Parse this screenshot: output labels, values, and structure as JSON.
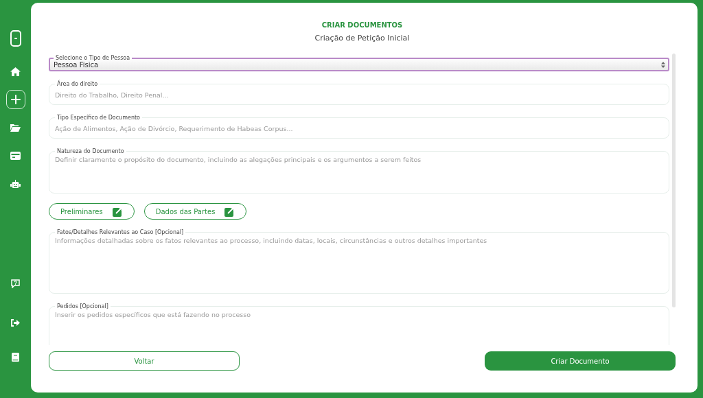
{
  "sidebar": {
    "top_items": [
      {
        "selected": false
      },
      {
        "selected": false
      },
      {
        "selected": true
      },
      {
        "selected": false
      },
      {
        "selected": false
      },
      {
        "selected": false
      }
    ],
    "bottom_items": [
      {
        "selected": false
      },
      {
        "selected": false
      },
      {
        "selected": false
      }
    ]
  },
  "header": {
    "title": "CRIAR DOCUMENTOS",
    "subtitle": "Criação de Petição Inicial"
  },
  "form": {
    "fields": [
      {
        "kind": "select",
        "label": "Selecione o Tipo de Pessoa",
        "value": "Pessoa Fisica"
      },
      {
        "kind": "text",
        "label": "Área do direito",
        "placeholder": "Direito do Trabalho, Direito Penal..."
      },
      {
        "kind": "text",
        "label": "Tipo Específico de Documento",
        "placeholder": "Ação de Alimentos, Ação de Divórcio, Requerimento de Habeas Corpus..."
      },
      {
        "kind": "textarea",
        "label": "Natureza do Documento",
        "placeholder": "Definir claramente o propósito do documento, incluindo as alegações principais e os argumentos a serem feitos"
      },
      {
        "kind": "links",
        "buttons": [
          {
            "label": "Preliminares"
          },
          {
            "label": "Dados das Partes"
          }
        ]
      },
      {
        "kind": "large_textarea",
        "label": "Fatos/Detalhes Relevantes ao Caso [Opcional]",
        "placeholder": "Informações detalhadas sobre os fatos relevantes ao processo, incluindo datas, locais, circunstâncias e outros detalhes importantes"
      },
      {
        "kind": "large_textarea",
        "label": "Pedidos [Opcional]",
        "placeholder": "Inserir os pedidos específicos que está fazendo no processo"
      }
    ]
  },
  "footer": {
    "back": "Voltar",
    "submit": "Criar Documento"
  }
}
